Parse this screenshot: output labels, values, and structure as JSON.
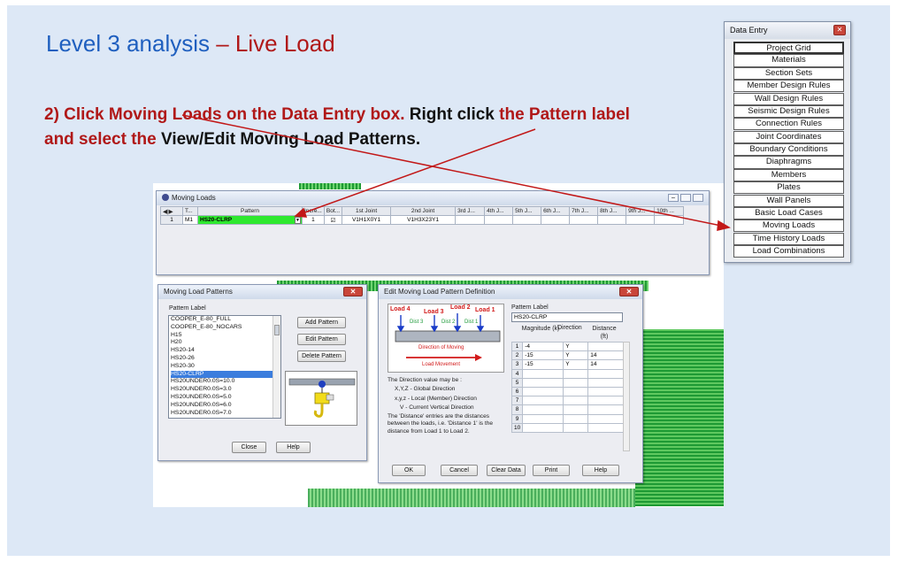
{
  "slide": {
    "title_part1": "Level 3 analysis ",
    "title_part2": "– Live Load",
    "instr_1": "2) Click Moving Loads on the Data Entry box. ",
    "instr_2": "Right click ",
    "instr_3": "the Pattern label and select the ",
    "instr_4": "View/Edit Moving Load Patterns."
  },
  "data_entry": {
    "title": "Data Entry",
    "close_glyph": "✕",
    "items": [
      "Project Grid",
      "Materials",
      "Section Sets",
      "Member Design Rules",
      "Wall Design Rules",
      "Seismic Design Rules",
      "Connection Rules",
      "Joint Coordinates",
      "Boundary Conditions",
      "Diaphragms",
      "Members",
      "Plates",
      "Wall Panels",
      "Basic Load Cases",
      "Moving Loads",
      "Time History Loads",
      "Load Combinations"
    ]
  },
  "moving_loads": {
    "title": "Moving Loads",
    "headers": [
      "",
      "T...",
      "Pattern",
      "Incre...",
      "Bot...",
      "1st Joint",
      "2nd Joint",
      "3rd J...",
      "4th J...",
      "5th J...",
      "6th J...",
      "7th J...",
      "8th J...",
      "9th J...",
      "10th ..."
    ],
    "row": {
      "num": "1",
      "tag": "M1",
      "pattern": "HS20-CLRP",
      "incr": "1",
      "bot": "☑",
      "j1": "V1H1X0Y1",
      "j2": "V1H3X23Y1"
    }
  },
  "patterns": {
    "title": "Moving Load Patterns",
    "label": "Pattern Label",
    "list": [
      "COOPER_E-80_FULL",
      "COOPER_E-80_NOCARS",
      "H15",
      "H20",
      "HS20-14",
      "HS20-26",
      "HS20-30",
      "HS20-CLRP",
      "HS20UNDER0.0S=10.0",
      "HS20UNDER0.0S=3.0",
      "HS20UNDER0.0S=5.0",
      "HS20UNDER0.0S=6.0",
      "HS20UNDER0.0S=7.0"
    ],
    "selected": 7,
    "buttons": {
      "add": "Add Pattern",
      "edit": "Edit Pattern",
      "delete": "Delete Pattern",
      "close": "Close",
      "help": "Help"
    }
  },
  "edit_def": {
    "title": "Edit Moving Load Pattern Definition",
    "pattern_label_caption": "Pattern Label",
    "pattern_label_value": "HS20-CLRP",
    "col_magnitude": "Magnitude (k)",
    "col_direction": "Direction",
    "col_distance": "Distance (ft)",
    "rows": [
      {
        "n": "1",
        "mag": "-4",
        "dir": "Y",
        "dist": ""
      },
      {
        "n": "2",
        "mag": "-15",
        "dir": "Y",
        "dist": "14"
      },
      {
        "n": "3",
        "mag": "-15",
        "dir": "Y",
        "dist": "14"
      },
      {
        "n": "4",
        "mag": "",
        "dir": "",
        "dist": ""
      },
      {
        "n": "5",
        "mag": "",
        "dir": "",
        "dist": ""
      },
      {
        "n": "6",
        "mag": "",
        "dir": "",
        "dist": ""
      },
      {
        "n": "7",
        "mag": "",
        "dir": "",
        "dist": ""
      },
      {
        "n": "8",
        "mag": "",
        "dir": "",
        "dist": ""
      },
      {
        "n": "9",
        "mag": "",
        "dir": "",
        "dist": ""
      },
      {
        "n": "10",
        "mag": "",
        "dir": "",
        "dist": ""
      }
    ],
    "diagram": {
      "load4": "Load 4",
      "load3": "Load 3",
      "load2": "Load 2",
      "load1": "Load 1",
      "dist3": "Dist 3",
      "dist2": "Dist 2",
      "dist1": "Dist 1",
      "direction": "Direction of Moving",
      "movement": "Load Movement"
    },
    "help_lines": [
      "The Direction value may be :",
      "X,Y,Z  -  Global Direction",
      "x,y,z  -  Local (Member) Direction",
      "V  -  Current Vertical Direction",
      "The 'Distance' entries are the distances between the loads, i.e. 'Distance 1' is the distance from Load 1 to Load 2."
    ],
    "buttons": {
      "ok": "OK",
      "cancel": "Cancel",
      "clear": "Clear Data",
      "print": "Print",
      "help": "Help"
    }
  },
  "colors": {
    "title_blue": "#1f5fbf",
    "accent_red": "#b01818",
    "pattern_green": "#2fe82f",
    "selection": "#3b7ddd"
  }
}
